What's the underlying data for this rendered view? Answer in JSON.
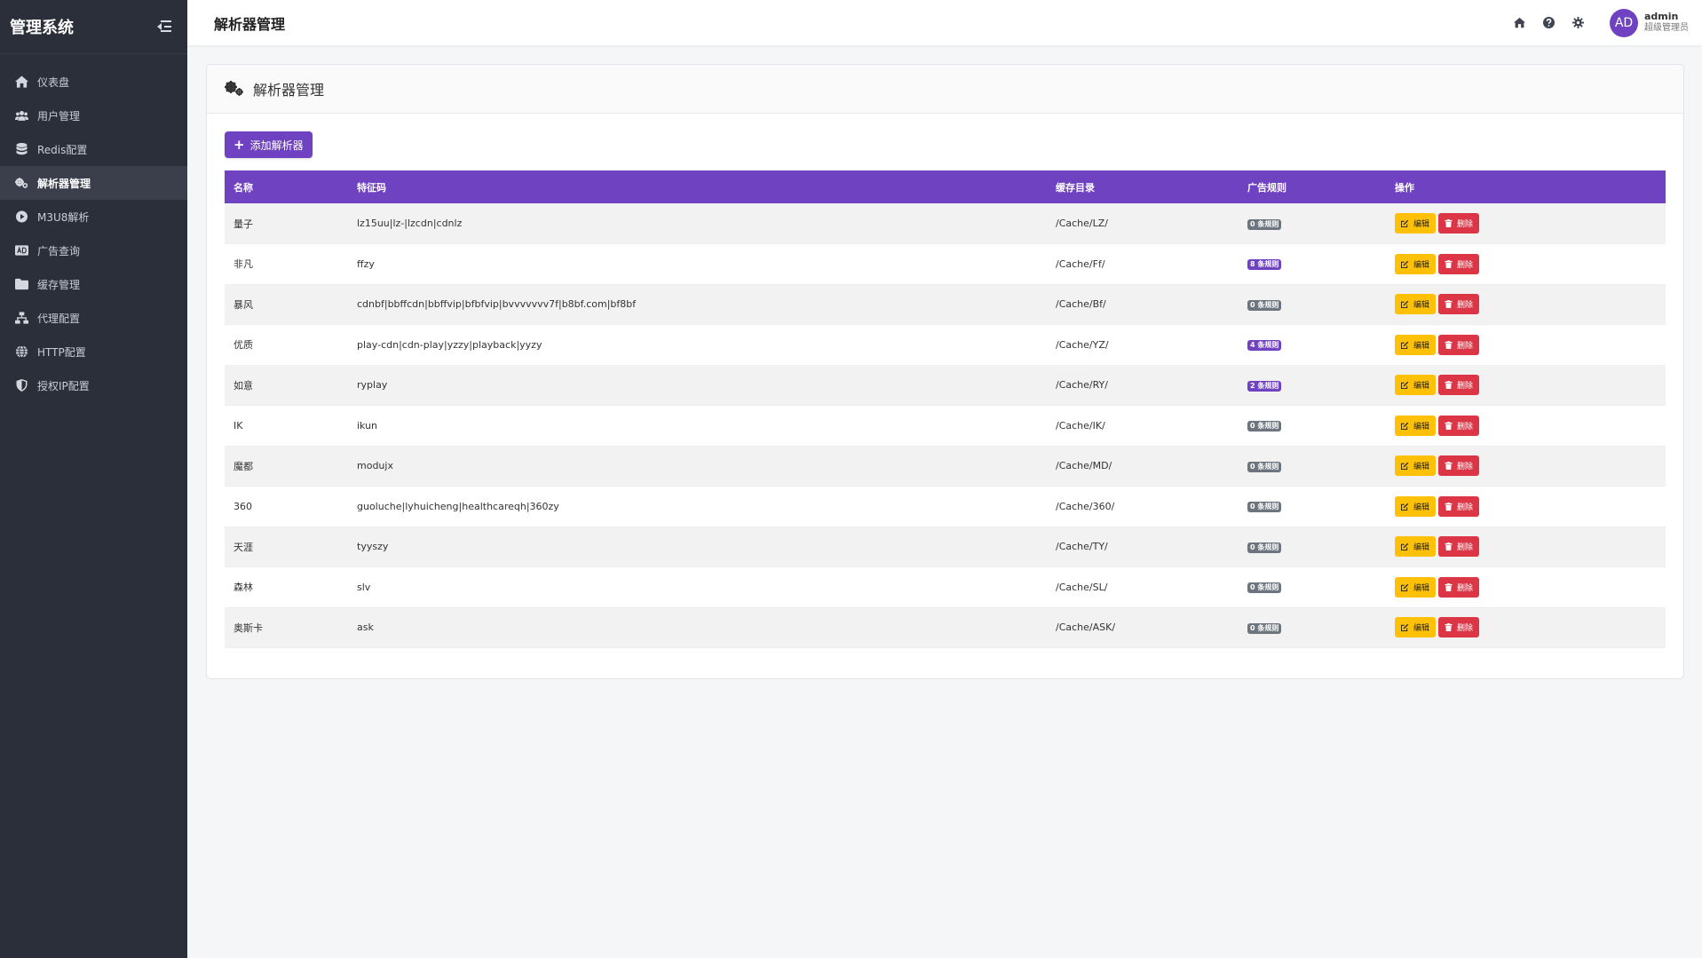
{
  "app": {
    "title": "管理系统"
  },
  "sidebar": {
    "items": [
      {
        "label": "仪表盘",
        "icon": "home-icon",
        "active": false
      },
      {
        "label": "用户管理",
        "icon": "users-icon",
        "active": false
      },
      {
        "label": "Redis配置",
        "icon": "database-icon",
        "active": false
      },
      {
        "label": "解析器管理",
        "icon": "gears-icon",
        "active": true
      },
      {
        "label": "M3U8解析",
        "icon": "play-circle-icon",
        "active": false
      },
      {
        "label": "广告查询",
        "icon": "ad-icon",
        "active": false
      },
      {
        "label": "缓存管理",
        "icon": "folder-icon",
        "active": false
      },
      {
        "label": "代理配置",
        "icon": "network-icon",
        "active": false
      },
      {
        "label": "HTTP配置",
        "icon": "globe-icon",
        "active": false
      },
      {
        "label": "授权IP配置",
        "icon": "shield-icon",
        "active": false
      }
    ]
  },
  "header": {
    "title": "解析器管理",
    "icons": [
      "home-icon",
      "help-icon",
      "settings-icon"
    ],
    "user": {
      "initials": "AD",
      "name": "admin",
      "role": "超级管理员"
    }
  },
  "card": {
    "title": "解析器管理",
    "add_label": "添加解析器"
  },
  "table": {
    "headers": {
      "name": "名称",
      "signature": "特征码",
      "cache": "缓存目录",
      "ad_rules": "广告规则",
      "actions": "操作"
    },
    "edit_label": "编辑",
    "delete_label": "删除",
    "rows": [
      {
        "name": "量子",
        "signature": "lz15uu|lz-|lzcdn|cdnlz",
        "cache": "/Cache/LZ/",
        "ad_rules": "0 条规则",
        "ad_count": 0
      },
      {
        "name": "非凡",
        "signature": "ffzy",
        "cache": "/Cache/Ff/",
        "ad_rules": "8 条规则",
        "ad_count": 8
      },
      {
        "name": "暴风",
        "signature": "cdnbf|bbffcdn|bbffvip|bfbfvip|bvvvvvvv7f|b8bf.com|bf8bf",
        "cache": "/Cache/Bf/",
        "ad_rules": "0 条规则",
        "ad_count": 0
      },
      {
        "name": "优质",
        "signature": "play-cdn|cdn-play|yzzy|playback|yyzy",
        "cache": "/Cache/YZ/",
        "ad_rules": "4 条规则",
        "ad_count": 4
      },
      {
        "name": "如意",
        "signature": "ryplay",
        "cache": "/Cache/RY/",
        "ad_rules": "2 条规则",
        "ad_count": 2
      },
      {
        "name": "IK",
        "signature": "ikun",
        "cache": "/Cache/IK/",
        "ad_rules": "0 条规则",
        "ad_count": 0
      },
      {
        "name": "魔都",
        "signature": "modujx",
        "cache": "/Cache/MD/",
        "ad_rules": "0 条规则",
        "ad_count": 0
      },
      {
        "name": "360",
        "signature": "guoluche|lyhuicheng|healthcareqh|360zy",
        "cache": "/Cache/360/",
        "ad_rules": "0 条规则",
        "ad_count": 0
      },
      {
        "name": "天涯",
        "signature": "tyyszy",
        "cache": "/Cache/TY/",
        "ad_rules": "0 条规则",
        "ad_count": 0
      },
      {
        "name": "森林",
        "signature": "slv",
        "cache": "/Cache/SL/",
        "ad_rules": "0 条规则",
        "ad_count": 0
      },
      {
        "name": "奥斯卡",
        "signature": "ask",
        "cache": "/Cache/ASK/",
        "ad_rules": "0 条规则",
        "ad_count": 0
      }
    ]
  },
  "colors": {
    "accent": "#6f42c1",
    "sidebar_bg": "#2b2f3a",
    "edit": "#ffc107",
    "delete": "#dc3545",
    "badge_zero": "#6c757d"
  }
}
